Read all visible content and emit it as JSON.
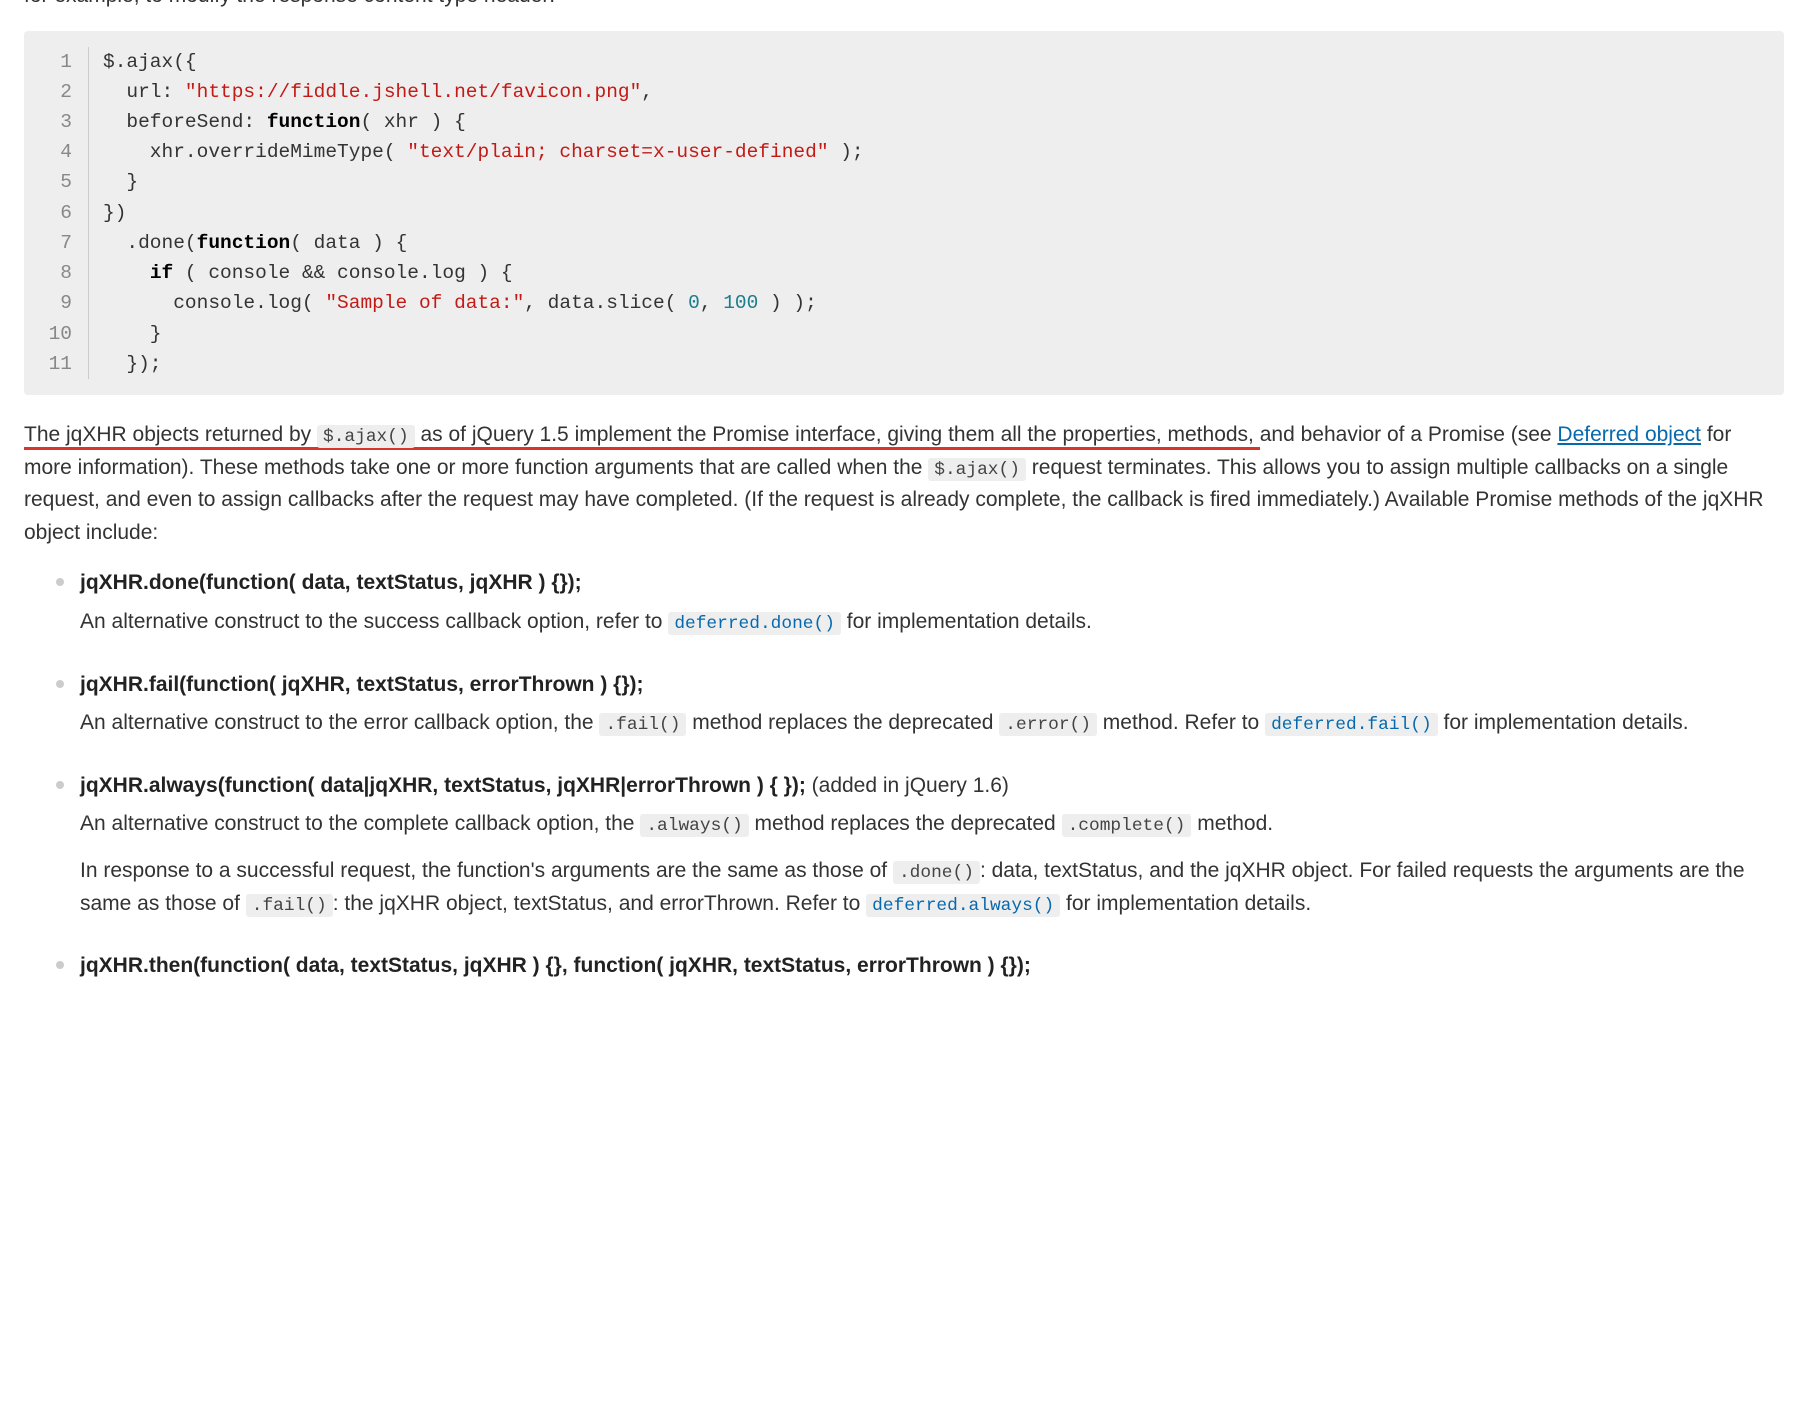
{
  "intro_clip": "for example, to modify the response content type header:",
  "code": {
    "lines": [
      [
        {
          "t": "plain",
          "v": "$.ajax({"
        }
      ],
      [
        {
          "t": "plain",
          "v": "  url: "
        },
        {
          "t": "str",
          "v": "\"https://fiddle.jshell.net/favicon.png\""
        },
        {
          "t": "plain",
          "v": ","
        }
      ],
      [
        {
          "t": "plain",
          "v": "  beforeSend: "
        },
        {
          "t": "kw",
          "v": "function"
        },
        {
          "t": "plain",
          "v": "( xhr ) {"
        }
      ],
      [
        {
          "t": "plain",
          "v": "    xhr.overrideMimeType( "
        },
        {
          "t": "str",
          "v": "\"text/plain; charset=x-user-defined\""
        },
        {
          "t": "plain",
          "v": " );"
        }
      ],
      [
        {
          "t": "plain",
          "v": "  }"
        }
      ],
      [
        {
          "t": "plain",
          "v": "})"
        }
      ],
      [
        {
          "t": "plain",
          "v": "  .done("
        },
        {
          "t": "kw",
          "v": "function"
        },
        {
          "t": "plain",
          "v": "( data ) {"
        }
      ],
      [
        {
          "t": "plain",
          "v": "    "
        },
        {
          "t": "kw",
          "v": "if"
        },
        {
          "t": "plain",
          "v": " ( console && console.log ) {"
        }
      ],
      [
        {
          "t": "plain",
          "v": "      console.log( "
        },
        {
          "t": "str",
          "v": "\"Sample of data:\""
        },
        {
          "t": "plain",
          "v": ", data.slice( "
        },
        {
          "t": "num",
          "v": "0"
        },
        {
          "t": "plain",
          "v": ", "
        },
        {
          "t": "num",
          "v": "100"
        },
        {
          "t": "plain",
          "v": " ) );"
        }
      ],
      [
        {
          "t": "plain",
          "v": "    }"
        }
      ],
      [
        {
          "t": "plain",
          "v": "  });"
        }
      ]
    ]
  },
  "para": {
    "p1_underlined": "The jqXHR objects returned by ",
    "code1": "$.ajax()",
    "p1_underlined_after": " as of jQuery 1.5 implement the Promise interface, giving them all the properties, methods,",
    "p1_rest_before_link": " and behavior of a Promise (see ",
    "link_text": "Deferred object",
    "p1_rest_after_link": " for more information). These methods take one or more function arguments that are called when the ",
    "code2": "$.ajax()",
    "p1_tail": " request terminates. This allows you to assign multiple callbacks on a single request, and even to assign callbacks after the request may have completed. (If the request is already complete, the callback is fired immediately.) Available Promise methods of the jqXHR object include:"
  },
  "methods": {
    "done": {
      "sig": "jqXHR.done(function( data, textStatus, jqXHR ) {});",
      "desc_before": "An alternative construct to the success callback option, refer to ",
      "code_ref": "deferred.done()",
      "desc_after": " for implementation details."
    },
    "fail": {
      "sig": "jqXHR.fail(function( jqXHR, textStatus, errorThrown ) {});",
      "desc_before": "An alternative construct to the error callback option, the ",
      "code1": ".fail()",
      "desc_mid1": " method replaces the deprecated ",
      "code2": ".error()",
      "desc_mid2": " method. Refer to ",
      "code_ref": "deferred.fail()",
      "desc_after": " for implementation details."
    },
    "always": {
      "sig": "jqXHR.always(function( data|jqXHR, textStatus, jqXHR|errorThrown ) { });",
      "added": " (added in jQuery 1.6)",
      "p1_before": "An alternative construct to the complete callback option, the ",
      "p1_code1": ".always()",
      "p1_mid": " method replaces the deprecated ",
      "p1_code2": ".complete()",
      "p1_after": " method.",
      "p2_before": "In response to a successful request, the function's arguments are the same as those of ",
      "p2_code1": ".done()",
      "p2_mid1": ": data, textStatus, and the jqXHR object. For failed requests the arguments are the same as those of ",
      "p2_code2": ".fail()",
      "p2_mid2": ": the jqXHR object, textStatus, and errorThrown. Refer to ",
      "p2_code_ref": "deferred.always()",
      "p2_after": " for implementation details."
    },
    "then": {
      "sig": "jqXHR.then(function( data, textStatus, jqXHR ) {}, function( jqXHR, textStatus, errorThrown ) {});"
    }
  }
}
